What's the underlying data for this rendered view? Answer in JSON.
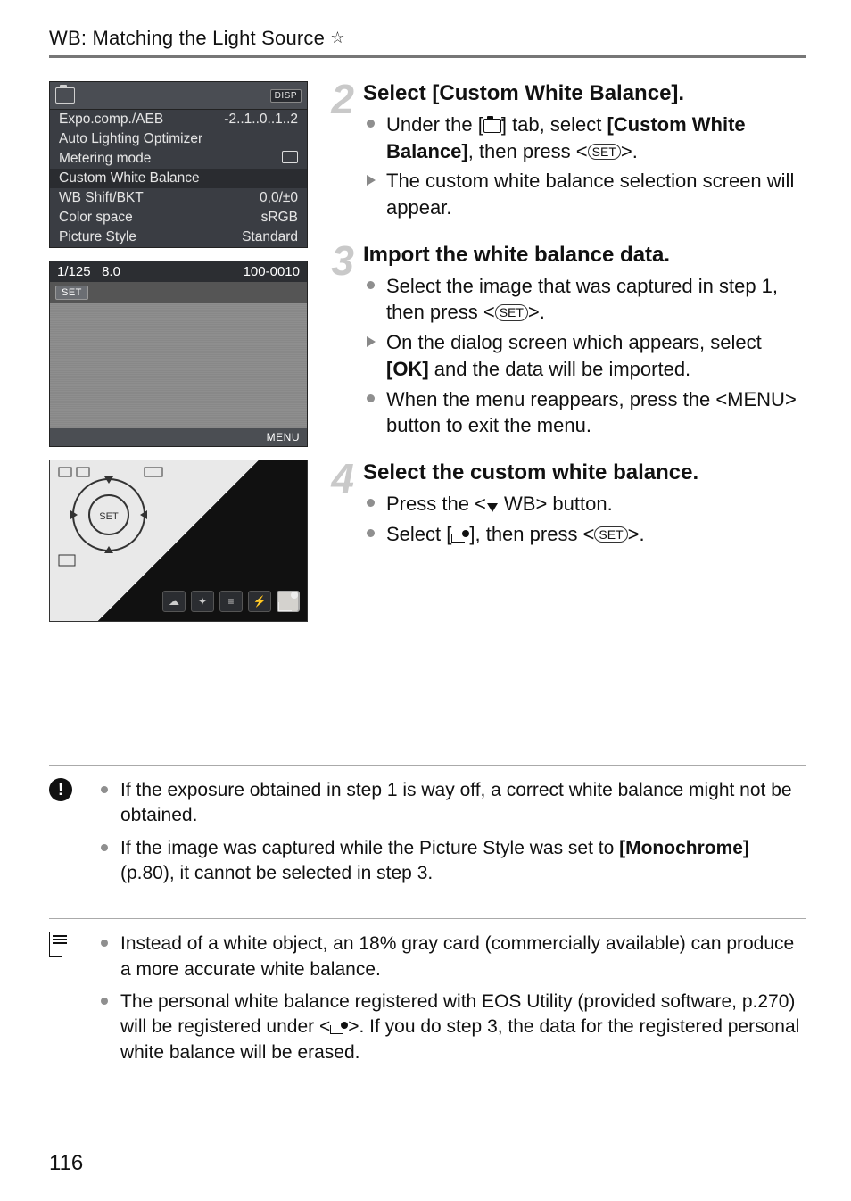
{
  "header": {
    "title": "WB: Matching the Light Source",
    "star": "☆"
  },
  "page_number": "116",
  "lcd1": {
    "disp": "DISP",
    "rows": [
      {
        "label": "Expo.comp./AEB",
        "value": "-2..1..0..1..2"
      },
      {
        "label": "Auto Lighting Optimizer",
        "value": ""
      },
      {
        "label": "Metering mode",
        "value": "",
        "icon": true
      },
      {
        "label": "Custom White Balance",
        "value": "",
        "sel": true
      },
      {
        "label": "WB Shift/BKT",
        "value": "0,0/±0"
      },
      {
        "label": "Color space",
        "value": "sRGB"
      },
      {
        "label": "Picture Style",
        "value": "Standard"
      }
    ]
  },
  "lcd2": {
    "shutter": "1/125",
    "aperture": "8.0",
    "file": "100-0010",
    "tag": "SET",
    "menu": "MENU"
  },
  "steps": {
    "s2": {
      "num": "2",
      "title": "Select [Custom White Balance].",
      "b1a": "Under the [",
      "b1b": "] tab, select ",
      "b1c": "[Custom White Balance]",
      "b1d": ", then press <",
      "b1e": ">.",
      "b2": "The custom white balance selection screen will appear."
    },
    "s3": {
      "num": "3",
      "title": "Import the white balance data.",
      "b1a": "Select the image that was captured in step 1, then press <",
      "b1b": ">.",
      "b2a": "On the dialog screen which appears, select ",
      "b2b": "[OK]",
      "b2c": " and the data will be imported.",
      "b3": "When the menu reappears, press the <MENU> button to exit the menu."
    },
    "s4": {
      "num": "4",
      "title": "Select the custom white balance.",
      "b1a": "Press the <",
      "b1b": " WB> button.",
      "b2a": "Select [",
      "b2b": "], then press <",
      "b2c": ">."
    }
  },
  "warn": {
    "n1": "If the exposure obtained in step 1 is way off, a correct white balance might not be obtained.",
    "n2a": "If the image was captured while the Picture Style was set to ",
    "n2b": "[Monochrome]",
    "n2c": " (p.80), it cannot be selected in step 3."
  },
  "tip": {
    "n1": "Instead of a white object, an 18% gray card (commercially available) can produce a more accurate white balance.",
    "n2a": "The personal white balance registered with EOS Utility (provided software, p.270) will be registered under <",
    "n2b": ">. If you do step 3, the data for the registered personal white balance will be erased."
  },
  "set_label": "SET"
}
